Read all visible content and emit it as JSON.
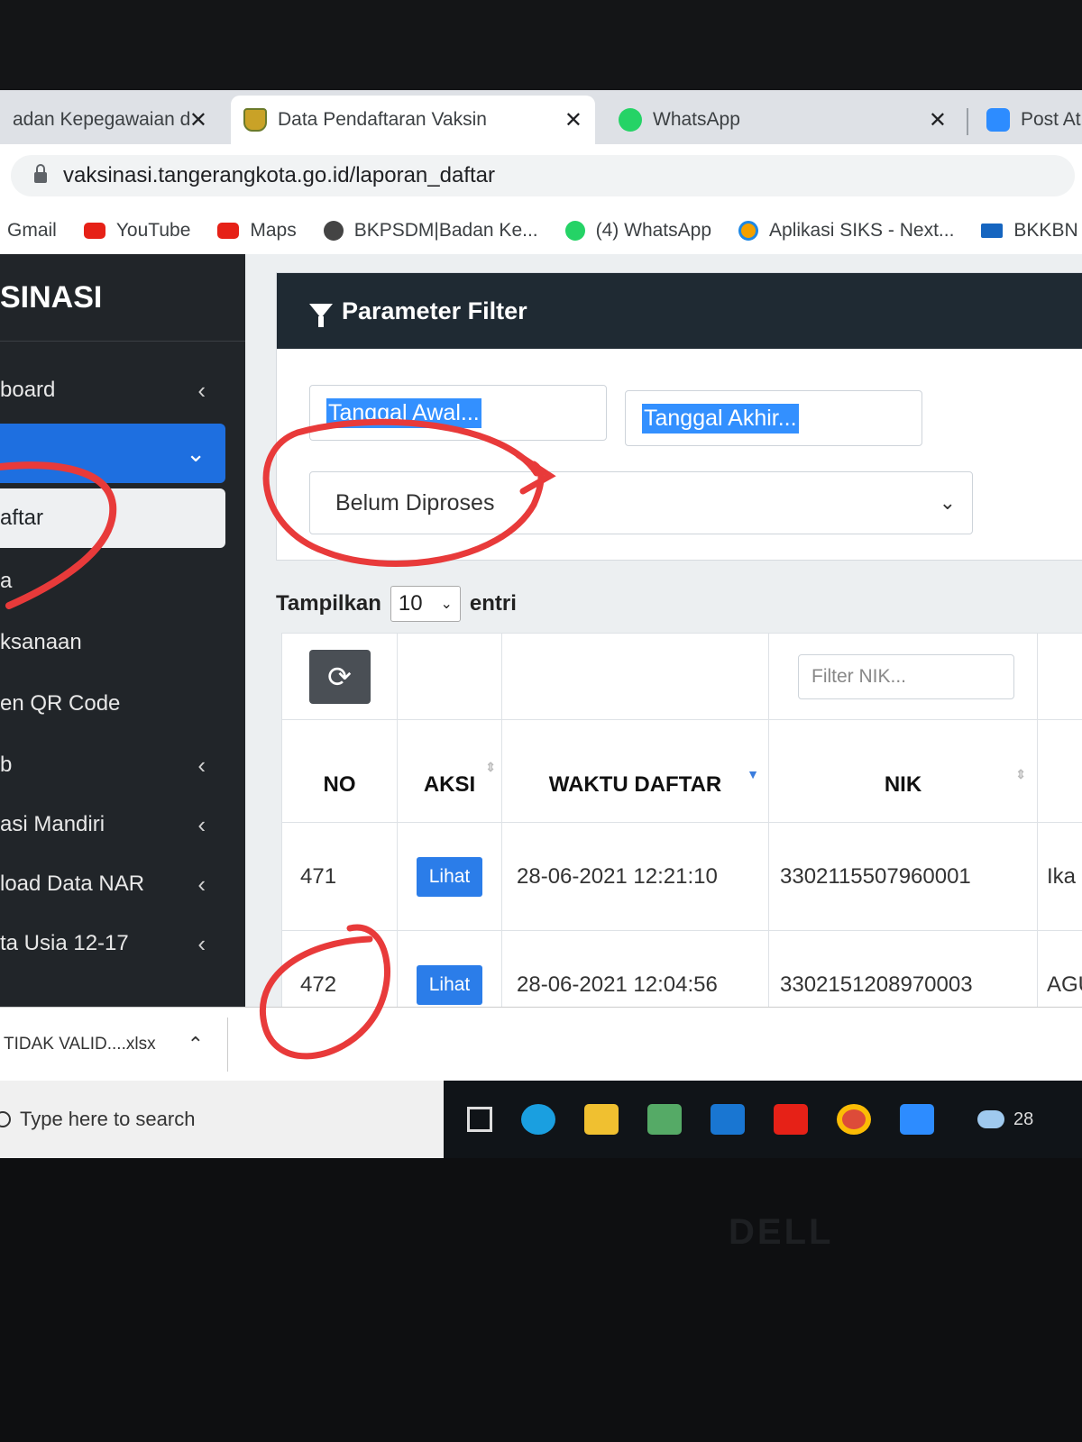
{
  "browser": {
    "tabs": [
      {
        "title": "adan Kepegawaian da",
        "close": "✕",
        "favicon": "none"
      },
      {
        "title": "Data Pendaftaran Vaksin",
        "close": "✕",
        "favicon": "gov-crest-icon"
      },
      {
        "title": "WhatsApp",
        "close": "✕",
        "favicon": "whatsapp-icon"
      },
      {
        "title": "Post At",
        "favicon": "zoom-icon"
      }
    ],
    "url": "vaksinasi.tangerangkota.go.id/laporan_daftar",
    "bookmarks": [
      "Gmail",
      "YouTube",
      "Maps",
      "BKPSDM|Badan Ke...",
      "(4) WhatsApp",
      "Aplikasi SIKS - Next...",
      "BKKBN"
    ]
  },
  "sidebar": {
    "brand": "SINASI",
    "items": [
      {
        "label": "board",
        "chevron": "‹"
      },
      {
        "label": "",
        "chevron": "⌄"
      },
      {
        "label": "aftar"
      },
      {
        "label": "a"
      },
      {
        "label": "ksanaan"
      },
      {
        "label": "en QR Code"
      },
      {
        "label": "b",
        "chevron": "‹"
      },
      {
        "label": "asi Mandiri",
        "chevron": "‹"
      },
      {
        "label": "load Data NAR",
        "chevron": "‹"
      },
      {
        "label": "ta Usia 12-17",
        "chevron": "‹"
      }
    ]
  },
  "filter": {
    "title": "Parameter Filter",
    "start_date_placeholder": "Tanggal Awal...",
    "end_date_placeholder": "Tanggal Akhir...",
    "status_selected": "Belum Diproses"
  },
  "table": {
    "length_prefix": "Tampilkan",
    "length_value": "10",
    "length_suffix": "entri",
    "nik_filter_placeholder": "Filter NIK...",
    "headers": [
      "NO",
      "AKSI",
      "WAKTU DAFTAR",
      "NIK"
    ],
    "rows": [
      {
        "no": "471",
        "action": "Lihat",
        "time": "28-06-2021 12:21:10",
        "nik": "3302115507960001",
        "name": "Ika"
      },
      {
        "no": "472",
        "action": "Lihat",
        "time": "28-06-2021 12:04:56",
        "nik": "3302151208970003",
        "name": "AGU"
      }
    ]
  },
  "download_bar": {
    "file": "TIDAK VALID....xlsx",
    "chevron": "⌃"
  },
  "taskbar": {
    "search": "Type here to search",
    "clock_partial": "28"
  },
  "laptop_logo": "DELL",
  "colors": {
    "annotation": "#e83a3a",
    "accent": "#1e6fe0",
    "sidebar": "#212529",
    "card_header": "#1f2a33"
  }
}
